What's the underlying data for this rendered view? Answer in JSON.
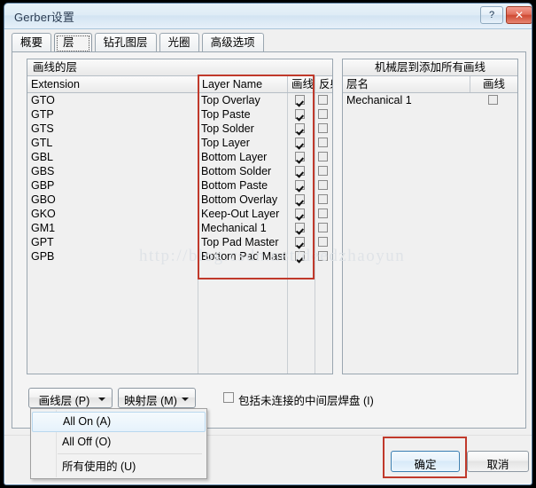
{
  "window": {
    "title": "Gerber设置",
    "help_button": "?",
    "close_button": "✕"
  },
  "tabs": [
    {
      "label": "概要",
      "selected": false
    },
    {
      "label": "层",
      "selected": true
    },
    {
      "label": "钻孔图层",
      "selected": false
    },
    {
      "label": "光圈",
      "selected": false
    },
    {
      "label": "高级选项",
      "selected": false
    }
  ],
  "left_group": {
    "title": "画线的层",
    "columns": [
      "Extension",
      "Layer Name",
      "画线",
      "反射"
    ],
    "rows": [
      {
        "extension": "GTO",
        "layer_name": "Top Overlay",
        "plot": true,
        "mirror": false
      },
      {
        "extension": "GTP",
        "layer_name": "Top Paste",
        "plot": true,
        "mirror": false
      },
      {
        "extension": "GTS",
        "layer_name": "Top Solder",
        "plot": true,
        "mirror": false
      },
      {
        "extension": "GTL",
        "layer_name": "Top Layer",
        "plot": true,
        "mirror": false
      },
      {
        "extension": "GBL",
        "layer_name": "Bottom Layer",
        "plot": true,
        "mirror": false
      },
      {
        "extension": "GBS",
        "layer_name": "Bottom Solder",
        "plot": true,
        "mirror": false
      },
      {
        "extension": "GBP",
        "layer_name": "Bottom Paste",
        "plot": true,
        "mirror": false
      },
      {
        "extension": "GBO",
        "layer_name": "Bottom Overlay",
        "plot": true,
        "mirror": false
      },
      {
        "extension": "GKO",
        "layer_name": "Keep-Out Layer",
        "plot": true,
        "mirror": false
      },
      {
        "extension": "GM1",
        "layer_name": "Mechanical 1",
        "plot": true,
        "mirror": false
      },
      {
        "extension": "GPT",
        "layer_name": "Top Pad Master",
        "plot": true,
        "mirror": false
      },
      {
        "extension": "GPB",
        "layer_name": "Bottom Pad Master",
        "plot": true,
        "mirror": false
      }
    ]
  },
  "right_group": {
    "title": "机械层到添加所有画线",
    "columns": [
      "层名",
      "画线"
    ],
    "rows": [
      {
        "layer_name": "Mechanical 1",
        "plot": false
      }
    ]
  },
  "actions": {
    "plot_layers_button": "画线层 (P)",
    "mapping_layers_button": "映射层 (M)",
    "include_unconnected_label": "包括未连接的中间层焊盘 (I)",
    "include_unconnected_checked": false
  },
  "menu": {
    "items": [
      {
        "label": "All On (A)",
        "highlighted": true
      },
      {
        "label": "All Off (O)",
        "highlighted": false
      },
      {
        "label": "所有使用的 (U)",
        "highlighted": false
      }
    ]
  },
  "footer": {
    "ok_label": "确定",
    "cancel_label": "取消"
  },
  "watermark": "http://blog.csdn.net/deedzhaoyun",
  "colors": {
    "annotation_red": "#c0392b",
    "dialog_bg": "#f0f0f0",
    "titlebar_blue": "#d3e4f2",
    "ok_border": "#3c7fb1"
  }
}
